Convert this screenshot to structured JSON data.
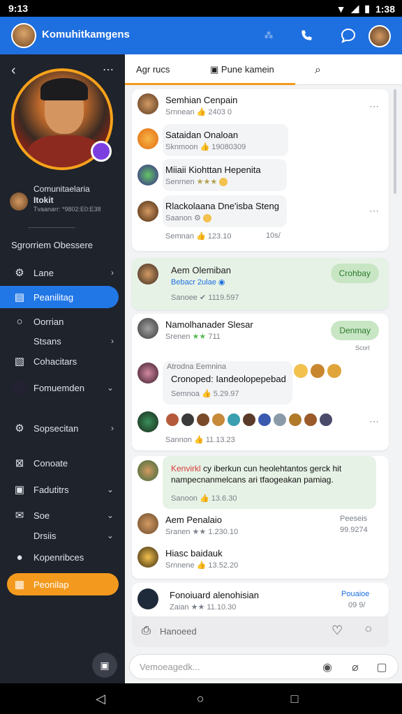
{
  "status": {
    "time": "9:13",
    "clock": "1:38",
    "icons": [
      "notification-icon",
      "wifi-icon",
      "signal-icon",
      "battery-icon"
    ]
  },
  "appbar": {
    "title": "Komuhitkamgens",
    "icons": [
      "translate-icon",
      "phone-icon",
      "chat-icon",
      "avatar"
    ]
  },
  "sidebar": {
    "profile_line1": "Comunitaelaria",
    "profile_line2": "Itokit",
    "profile_line3": "Tvaanarr: *9802:E0:E38",
    "section_title": "Sgrorriem Obessere",
    "items": [
      {
        "label": "Lane",
        "icon": "gear-icon",
        "chevron": "›"
      },
      {
        "label": "Peanilitag",
        "icon": "list-icon",
        "chevron": ""
      },
      {
        "label": "Oorrian",
        "icon": "search-icon",
        "chevron": ""
      },
      {
        "label": "Stsans",
        "icon": "",
        "chevron": "›"
      },
      {
        "label": "Cohacitars",
        "icon": "image-icon",
        "chevron": ""
      },
      {
        "label": "Fomuemden",
        "icon": "game-icon",
        "chevron": "⌄"
      },
      {
        "label": "Sopsecitan",
        "icon": "gear-icon",
        "chevron": "›"
      },
      {
        "label": "Conoate",
        "icon": "box-icon",
        "chevron": ""
      },
      {
        "label": "Fadutitrs",
        "icon": "bag-icon",
        "chevron": "⌄"
      },
      {
        "label": "Soe",
        "icon": "mail-icon",
        "chevron": "⌄"
      },
      {
        "label": "Drsiis",
        "icon": "",
        "chevron": "⌄"
      },
      {
        "label": "Kopenribces",
        "icon": "pin-icon",
        "chevron": ""
      },
      {
        "label": "Peonilap",
        "icon": "calendar-icon",
        "chevron": ""
      }
    ],
    "bottom_icon": "calendar-icon"
  },
  "tabs": [
    {
      "label": "Agr rucs"
    },
    {
      "label": "Pune kamein"
    },
    {
      "label": "search-icon"
    }
  ],
  "feed": {
    "card1": [
      {
        "name": "Semhian Cenpain",
        "sub": "Srnnean",
        "sub2": "2403 0"
      },
      {
        "name": "Sataidan Onaloan",
        "sub": "Sknmoon",
        "sub2": "19080309"
      },
      {
        "name": "Miiaii Kiohttan Hepenita",
        "sub": "Senrnen",
        "sub2": ""
      },
      {
        "name": "Rlackolaana Dne'isba Steng",
        "sub": "Saanon",
        "sub2": ""
      },
      {
        "name": "",
        "sub": "Semnan",
        "sub2": "123.10",
        "sub3": "10s/"
      }
    ],
    "card2": {
      "name": "Aem Olemiban",
      "sub_blue": "Bebacr 2ulae",
      "pill": "Crohbay",
      "sub": "Sanoee",
      "sub2": "1119.597"
    },
    "row3": {
      "name": "Namolhanader Slesar",
      "sub": "Srenen",
      "sub2": "711",
      "pill": "Denmay",
      "pill_sub": "Scorl"
    },
    "row4": {
      "name": "Atrodna Eemnina",
      "bubble": "Cronoped: Iandeolopepebad",
      "sub": "Semnoa",
      "sub2": "5.29.97"
    },
    "row5": {
      "sub": "Sannon",
      "sub2": "11.13.23"
    },
    "card3": {
      "text_red": "Kenvirkl",
      "text": "cy iberkun cun heolehtantos gerck hit nampecnanmelcans ari tfaogeakan pamiag.",
      "sub": "Sanoon",
      "sub2": "13.6.30"
    },
    "row6": {
      "name": "Aem Penalaio",
      "sub": "Sranen",
      "sub2": "1.230.10",
      "right1": "Peeseis",
      "right2": "99.9274"
    },
    "row7": {
      "name": "Hiasc baidauk",
      "sub": "Srnnene",
      "sub2": "13.52.20"
    },
    "row8": {
      "name": "Fonoiuard alenohisian",
      "sub": "Zaian",
      "sub2": "11.10.30",
      "right1": "Pouaioe",
      "right2": "09 9/"
    }
  },
  "footer": {
    "label": "Hanoeed"
  },
  "input": {
    "placeholder": "Vemoeagedk..."
  },
  "colors": {
    "accent": "#1e6fe0",
    "orange": "#f39a1e",
    "sidebar": "#1f232b",
    "green_pill": "#c8e6c4"
  }
}
